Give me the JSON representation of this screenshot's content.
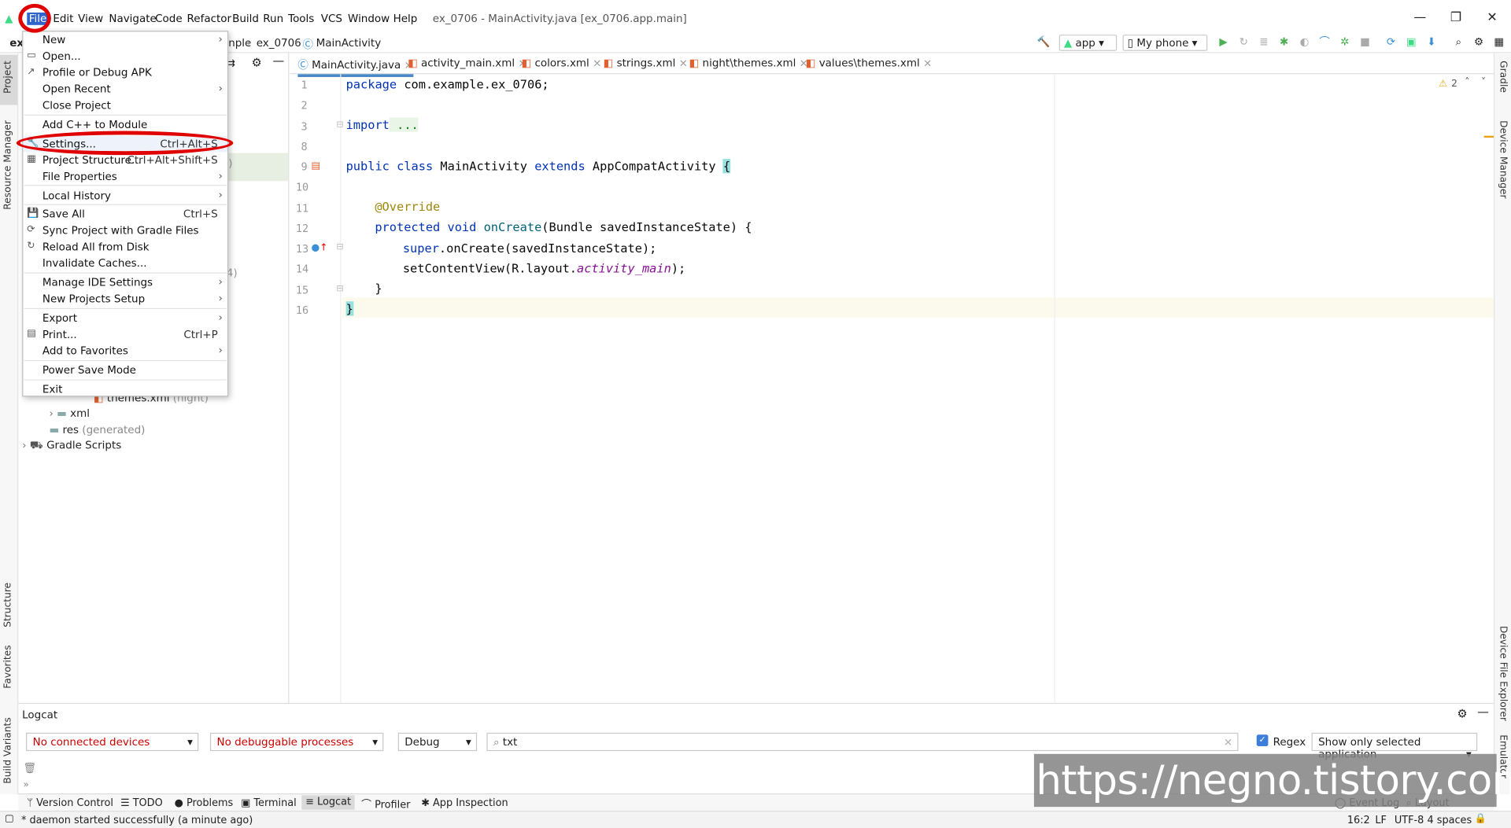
{
  "window": {
    "title": "ex_0706 - MainActivity.java [ex_0706.app.main]"
  },
  "menubar": [
    "File",
    "Edit",
    "View",
    "Navigate",
    "Code",
    "Refactor",
    "Build",
    "Run",
    "Tools",
    "VCS",
    "Window",
    "Help"
  ],
  "breadcrumb": {
    "project": "ex_",
    "part": "nple",
    "module": "ex_0706",
    "class": "MainActivity"
  },
  "toolbar": {
    "run_config": "app",
    "device": "My phone"
  },
  "left_tabs": [
    "Project",
    "Resource Manager",
    "Structure",
    "Favorites",
    "Build Variants"
  ],
  "right_tabs": [
    "Gradle",
    "Device Manager",
    "Device File Explorer",
    "Emulator"
  ],
  "file_menu": {
    "items": [
      {
        "label": "New",
        "arrow": true
      },
      {
        "label": "Open..."
      },
      {
        "label": "Profile or Debug APK"
      },
      {
        "label": "Open Recent",
        "arrow": true
      },
      {
        "label": "Close Project"
      },
      {
        "label": "Add C++ to Module"
      },
      {
        "label": "Settings...",
        "shortcut": "Ctrl+Alt+S"
      },
      {
        "label": "Project Structure...",
        "shortcut": "Ctrl+Alt+Shift+S"
      },
      {
        "label": "File Properties",
        "arrow": true
      },
      {
        "label": "Local History",
        "arrow": true
      },
      {
        "label": "Save All",
        "shortcut": "Ctrl+S"
      },
      {
        "label": "Sync Project with Gradle Files"
      },
      {
        "label": "Reload All from Disk"
      },
      {
        "label": "Invalidate Caches..."
      },
      {
        "label": "Manage IDE Settings",
        "arrow": true
      },
      {
        "label": "New Projects Setup",
        "arrow": true
      },
      {
        "label": "Export",
        "arrow": true
      },
      {
        "label": "Print...",
        "shortcut": "Ctrl+P"
      },
      {
        "label": "Add to Favorites",
        "arrow": true
      },
      {
        "label": "Power Save Mode"
      },
      {
        "label": "Exit"
      }
    ]
  },
  "project_tree": [
    {
      "label": "themes.xml",
      "suffix": "(night)"
    },
    {
      "label": "xml"
    },
    {
      "label": "res",
      "suffix": "(generated)"
    },
    {
      "label": "Gradle Scripts"
    }
  ],
  "tree_fragments": {
    "a": ")",
    "b": "4)"
  },
  "editor": {
    "tabs": [
      "MainActivity.java",
      "activity_main.xml",
      "colors.xml",
      "strings.xml",
      "night\\themes.xml",
      "values\\themes.xml"
    ],
    "warnings": "2",
    "lines": [
      "1",
      "2",
      "3",
      "8",
      "9",
      "10",
      "11",
      "12",
      "13",
      "14",
      "15",
      "16"
    ],
    "code": {
      "l1a": "package",
      "l1b": " com.example.ex_0706;",
      "l3a": "import",
      "l3b": " ...",
      "l9a": "public class",
      "l9b": " MainActivity ",
      "l9c": "extends",
      "l9d": " AppCompatActivity ",
      "l9e": "{",
      "l11": "@Override",
      "l12a": "protected void",
      "l12b": "onCreate",
      "l12c": "(Bundle savedInstanceState) {",
      "l13a": "super",
      "l13b": ".onCreate(savedInstanceState);",
      "l14a": "setContentView(R.layout.",
      "l14b": "activity_main",
      "l14c": ");",
      "l15": "}",
      "l16": "}"
    }
  },
  "logcat": {
    "title": "Logcat",
    "device": "No connected devices",
    "process": "No debuggable processes",
    "level": "Debug",
    "search": "txt",
    "regex_label": "Regex",
    "filter": "Show only selected application"
  },
  "bottom_tabs": [
    "Version Control",
    "TODO",
    "Problems",
    "Terminal",
    "Logcat",
    "Profiler",
    "App Inspection",
    "Event Log",
    "Layout Inspector"
  ],
  "status": {
    "message": "* daemon started successfully (a minute ago)",
    "position": "16:2",
    "line_sep": "LF",
    "encoding": "UTF-8",
    "indent": "4 spaces"
  },
  "watermark": "https://negno.tistory.com",
  "colors": {
    "highlight_red": "#e00000",
    "keyword": "#0033b3",
    "annotation": "#9e880d",
    "method": "#00627a"
  }
}
